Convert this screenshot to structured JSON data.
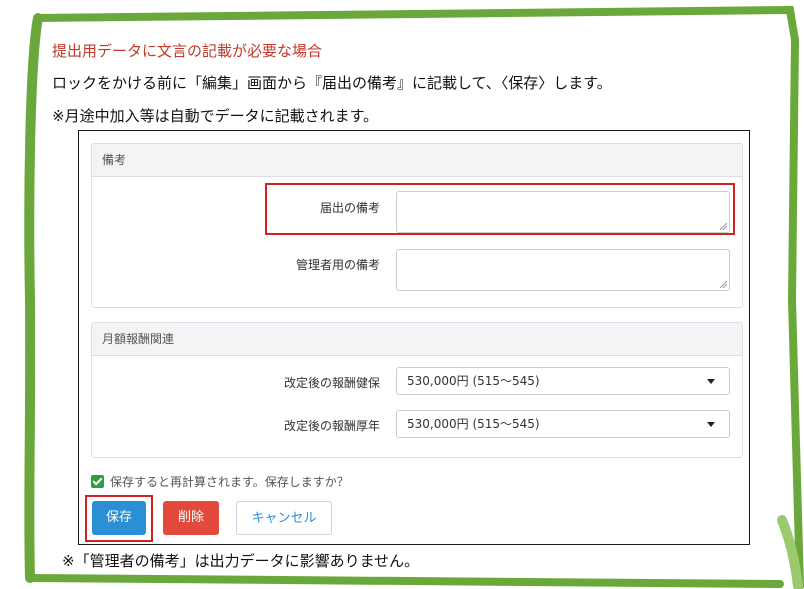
{
  "instructions": {
    "heading": "提出用データに文言の記載が必要な場合",
    "line1": "ロックをかける前に「編集」画面から『届出の備考』に記載して、〈保存〉します。",
    "line2": "※月途中加入等は自動でデータに記載されます。",
    "footnote": "※「管理者の備考」は出力データに影響ありません。"
  },
  "form": {
    "remarks_panel": {
      "title": "備考",
      "fields": [
        {
          "label": "届出の備考",
          "value": ""
        },
        {
          "label": "管理者用の備考",
          "value": ""
        }
      ]
    },
    "salary_panel": {
      "title": "月額報酬関連",
      "fields": [
        {
          "label": "改定後の報酬健保",
          "selected": "530,000円 (515～545)"
        },
        {
          "label": "改定後の報酬厚年",
          "selected": "530,000円 (515～545)"
        }
      ]
    },
    "confirm_checkbox": {
      "label": "保存すると再計算されます。保存しますか？",
      "checked": true
    },
    "buttons": {
      "save": "保存",
      "delete": "削除",
      "cancel": "キャンセル"
    }
  },
  "colors": {
    "frame_green": "#6aa83c",
    "heading_red": "#c0392b",
    "highlight_red": "#d32020",
    "save_blue": "#2b8fd6",
    "delete_red": "#e24b3b",
    "check_green": "#2e9e3e"
  }
}
